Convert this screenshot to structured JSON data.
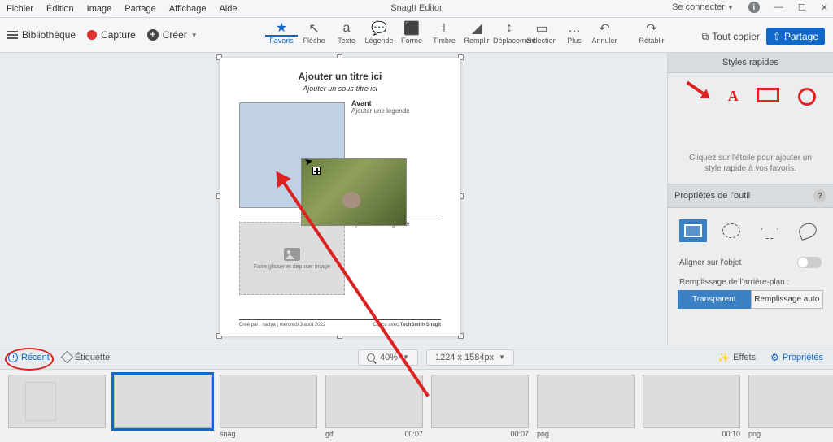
{
  "app_title": "SnagIt Editor",
  "menu": {
    "file": "Fichier",
    "edit": "Édition",
    "image": "Image",
    "share": "Partage",
    "view": "Affichage",
    "help": "Aide"
  },
  "titlebar": {
    "signin": "Se connecter"
  },
  "toolbar_left": {
    "library": "Bibliothèque",
    "capture": "Capture",
    "create": "Créer"
  },
  "tools": {
    "fav": "Favoris",
    "arrow": "Flèche",
    "text": "Texte",
    "callout": "Légende",
    "shape": "Forme",
    "stamp": "Timbre",
    "fill": "Remplir",
    "move": "Déplacement",
    "select": "Sélection",
    "more": "Plus",
    "undo": "Annuler",
    "redo": "Rétablir"
  },
  "actions": {
    "copy_all": "Tout copier",
    "share": "Partage"
  },
  "canvas": {
    "title": "Ajouter un titre ici",
    "subtitle": "Ajouter un sous-titre ici",
    "section1": "Avant",
    "caption": "Ajouter une légende",
    "drop_hint": "Faire glisser et déposer image",
    "footer_left": "Créé par : nadya   |   mercredi 3 août 2022",
    "footer_mid": "Conçu avec",
    "footer_brand": "TechSmith Snagit"
  },
  "quick_styles": {
    "header": "Styles rapides",
    "hint": "Cliquez sur l'étoile pour ajouter un style rapide à vos favoris."
  },
  "tool_props": {
    "header": "Propriétés de l'outil",
    "align": "Aligner sur l'objet",
    "bg_fill": "Remplissage de l'arrière-plan :",
    "transparent": "Transparent",
    "autofill": "Remplissage auto"
  },
  "status": {
    "recent": "Récent",
    "tag": "Étiquette",
    "zoom": "40%",
    "dims": "1224 x 1584px",
    "effects": "Effets",
    "properties": "Propriétés"
  },
  "tray": {
    "t3": "snag",
    "t4": "gif",
    "t4_time": "00:07",
    "t5_time": "00:07",
    "t6": "png",
    "t7_time": "00:10",
    "t8": "png"
  }
}
